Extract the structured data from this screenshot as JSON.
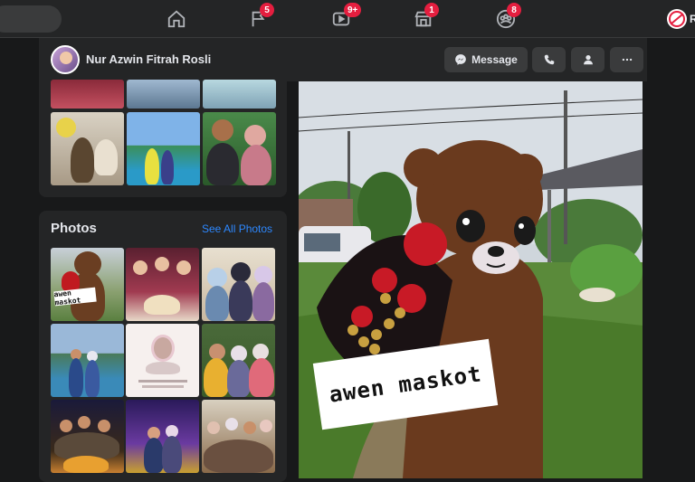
{
  "nav": {
    "pages_badge": "5",
    "watch_badge": "9+",
    "marketplace_badge": "1",
    "groups_badge": "8",
    "profile_label": "R"
  },
  "profile": {
    "name": "Nur Azwin Fitrah Rosli",
    "message_label": "Message"
  },
  "photos": {
    "title": "Photos",
    "see_all": "See All Photos",
    "caption_small": "awen maskot"
  },
  "main_photo": {
    "caption": "awen maskot"
  },
  "colors": {
    "background": "#18191a",
    "surface": "#242526",
    "button": "#3a3b3c",
    "link": "#2d88ff",
    "badge": "#e41e3f"
  }
}
